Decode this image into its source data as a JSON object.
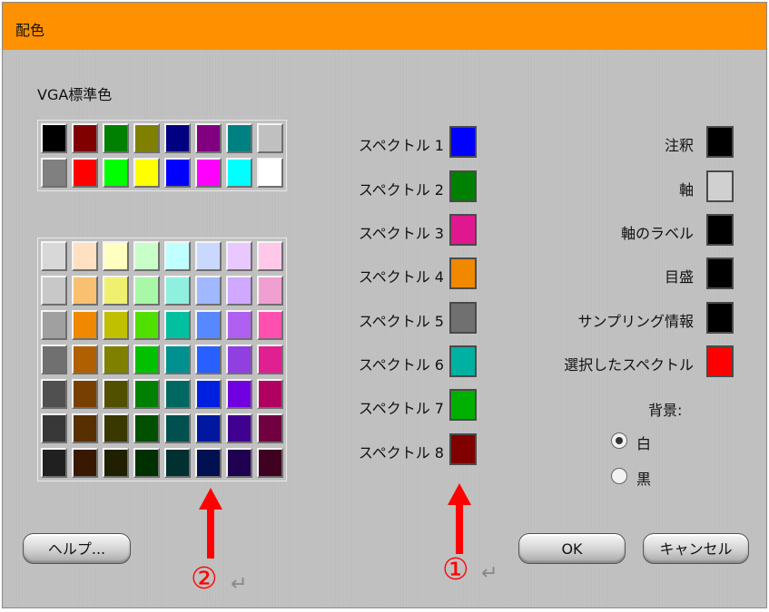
{
  "window": {
    "title": "配色"
  },
  "palette": {
    "title": "VGA標準色",
    "standard_colors": [
      "#000000",
      "#800000",
      "#008000",
      "#808000",
      "#000080",
      "#800080",
      "#008080",
      "#c0c0c0",
      "#808080",
      "#ff0000",
      "#00ff00",
      "#ffff00",
      "#0000ff",
      "#ff00ff",
      "#00ffff",
      "#ffffff"
    ],
    "palette_colors": [
      "#d8d8d8",
      "#ffe0c0",
      "#ffffc0",
      "#c8ffc8",
      "#c0ffff",
      "#c8d8ff",
      "#e8c8ff",
      "#ffc8e8",
      "#c8c8c8",
      "#f8c070",
      "#f0f070",
      "#a8f8a8",
      "#90f0e0",
      "#a0b8ff",
      "#d0a8ff",
      "#f0a0d0",
      "#a0a0a0",
      "#f08800",
      "#c0c000",
      "#50e000",
      "#00c0a0",
      "#5888ff",
      "#b060f0",
      "#ff50b0",
      "#707070",
      "#b06000",
      "#808000",
      "#00c000",
      "#009090",
      "#2860ff",
      "#9040e0",
      "#e02090",
      "#505050",
      "#784000",
      "#505000",
      "#008000",
      "#006860",
      "#0020e0",
      "#7000e0",
      "#b00060",
      "#383838",
      "#583000",
      "#383800",
      "#005000",
      "#005050",
      "#0018a0",
      "#400090",
      "#700040",
      "#202020",
      "#381800",
      "#202000",
      "#003000",
      "#003030",
      "#001050",
      "#200050",
      "#400020"
    ]
  },
  "spectrum": [
    {
      "label": "スペクトル 1",
      "color": "#0000ff"
    },
    {
      "label": "スペクトル 2",
      "color": "#008000"
    },
    {
      "label": "スペクトル 3",
      "color": "#e01890"
    },
    {
      "label": "スペクトル 4",
      "color": "#f08800"
    },
    {
      "label": "スペクトル 5",
      "color": "#707070"
    },
    {
      "label": "スペクトル 6",
      "color": "#00b0a0"
    },
    {
      "label": "スペクトル 7",
      "color": "#00b000"
    },
    {
      "label": "スペクトル 8",
      "color": "#800000"
    }
  ],
  "elements": [
    {
      "label": "注釈",
      "color": "#000000"
    },
    {
      "label": "軸",
      "color": "#d0d0d0"
    },
    {
      "label": "軸のラベル",
      "color": "#000000"
    },
    {
      "label": "目盛",
      "color": "#000000"
    },
    {
      "label": "サンプリング情報",
      "color": "#000000"
    },
    {
      "label": "選択したスペクトル",
      "color": "#ff0000"
    }
  ],
  "background": {
    "title": "背景:",
    "options": [
      {
        "label": "白",
        "selected": true
      },
      {
        "label": "黒",
        "selected": false
      }
    ]
  },
  "buttons": {
    "help": "ヘルプ...",
    "ok": "OK",
    "cancel": "キャンセル"
  },
  "annotations": {
    "marker_1": "①",
    "marker_2": "②",
    "return_mark": "↵",
    "color": "#ff0000"
  }
}
